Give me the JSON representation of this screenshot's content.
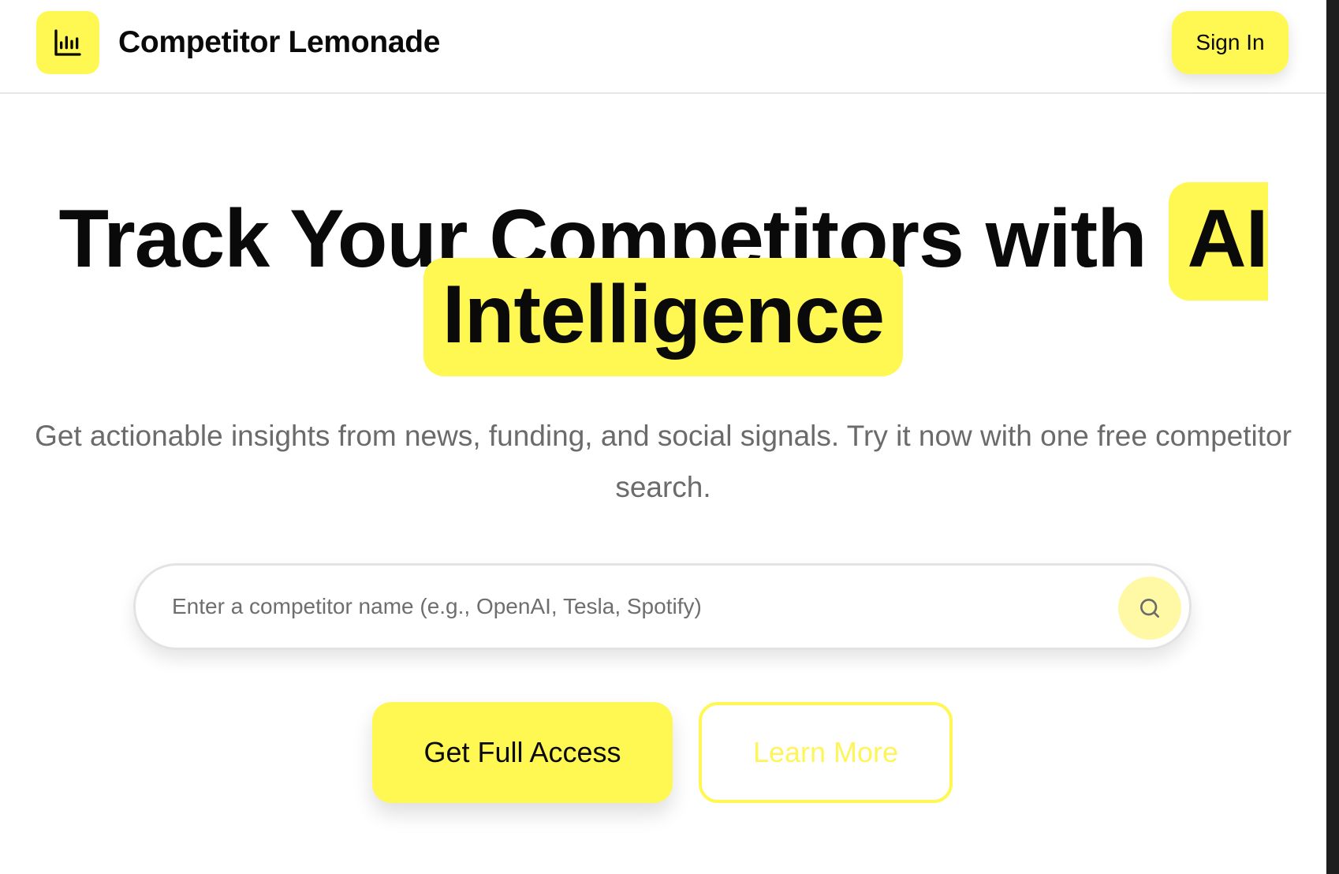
{
  "header": {
    "brand": "Competitor Lemonade",
    "logo_icon": "bar-chart-icon",
    "signin_label": "Sign In"
  },
  "hero": {
    "title_part1": "Track Your Competitors with",
    "title_highlight_1": "AI",
    "title_highlight_2": "Intelligence",
    "subtitle": "Get actionable insights from news, funding, and social signals. Try it now with one free competitor search."
  },
  "search": {
    "placeholder": "Enter a competitor name (e.g., OpenAI, Tesla, Spotify)",
    "value": "",
    "button_icon": "search-icon"
  },
  "cta": {
    "primary_label": "Get Full Access",
    "secondary_label": "Learn More"
  },
  "colors": {
    "accent": "#fff853",
    "accent_soft": "#fff9a6",
    "text": "#0a0a0a",
    "muted": "#6b6b6b"
  }
}
